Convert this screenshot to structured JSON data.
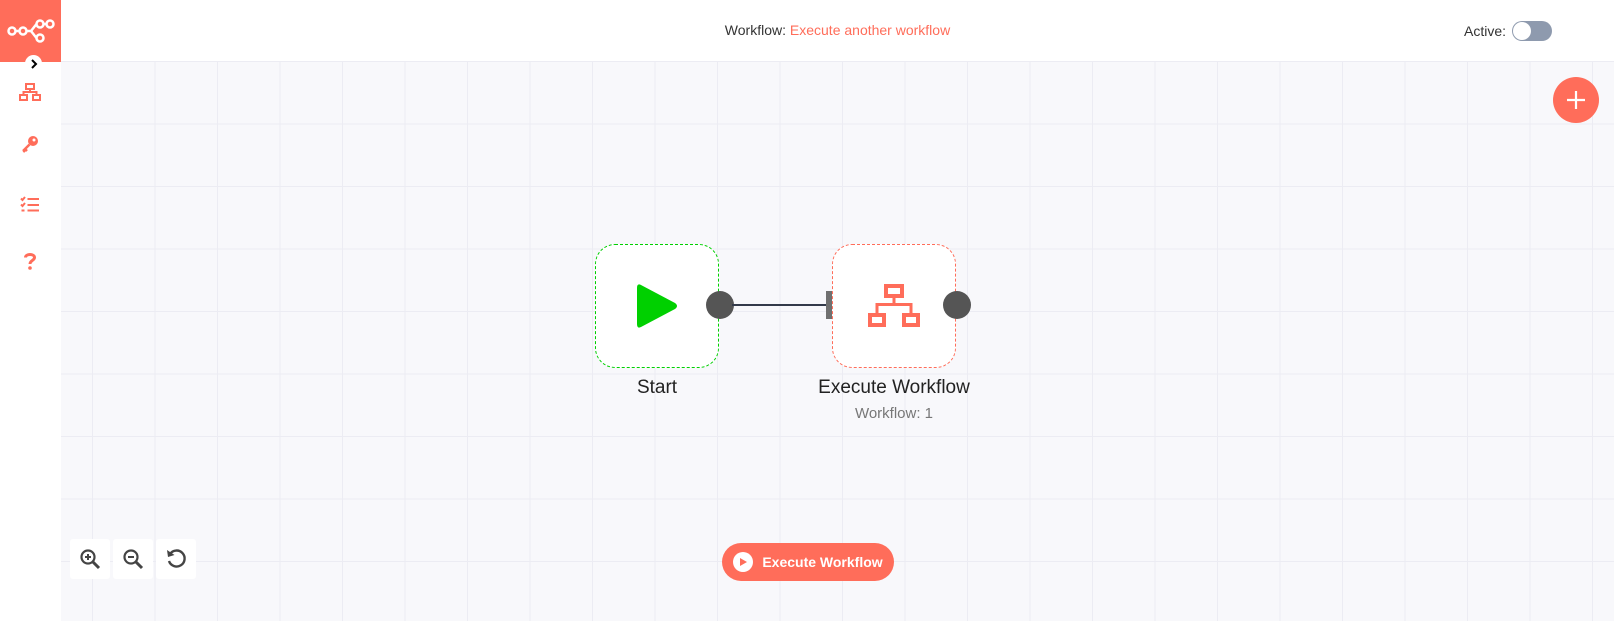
{
  "header": {
    "workflow_prefix": "Workflow:",
    "workflow_name": "Execute another workflow",
    "active_label": "Active:",
    "active": false
  },
  "sidebar": {
    "items": [
      {
        "name": "workflows",
        "icon": "network-icon"
      },
      {
        "name": "credentials",
        "icon": "key-icon"
      },
      {
        "name": "executions",
        "icon": "tasks-icon"
      },
      {
        "name": "help",
        "icon": "question-icon"
      }
    ]
  },
  "nodes": [
    {
      "label": "Start",
      "subtitle": "",
      "icon": "play-icon",
      "color": "#00d000"
    },
    {
      "label": "Execute Workflow",
      "subtitle": "Workflow: 1",
      "icon": "network-icon",
      "color": "#ff6d5a"
    }
  ],
  "toolbar": {
    "execute_label": "Execute Workflow",
    "zoom_in": "zoom-in-icon",
    "zoom_out": "zoom-out-icon",
    "reset": "undo-icon"
  },
  "colors": {
    "brand": "#ff6d5a",
    "start": "#00d000",
    "canvas": "#f8f8fb"
  }
}
